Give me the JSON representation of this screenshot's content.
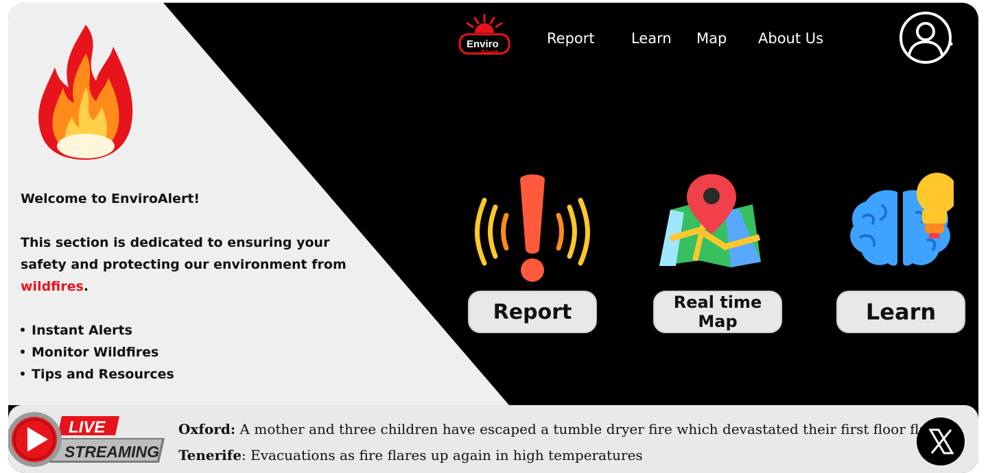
{
  "brand": {
    "name_top": "Enviro",
    "name_bottom": "Alert",
    "accent": "#e8141b"
  },
  "nav": {
    "items": [
      "Report",
      "Learn",
      "Map",
      "About Us"
    ]
  },
  "profile": {
    "icon": "user-icon"
  },
  "intro": {
    "welcome": "Welcome to EnviroAlert!",
    "text_before": "This section  is dedicated to ensuring your safety and protecting our environment from ",
    "highlight": "wildfires",
    "text_after": ".",
    "features": [
      "Instant Alerts",
      "Monitor Wildfires",
      "Tips and Resources"
    ]
  },
  "cards": [
    {
      "label": "Report",
      "icon": "alert-icon"
    },
    {
      "label": "Real time Map",
      "icon": "map-pin-icon"
    },
    {
      "label": "Learn",
      "icon": "brain-bulb-icon"
    }
  ],
  "ticker": {
    "badge_top": "LIVE",
    "badge_bottom": "STREAMING",
    "items": [
      {
        "place": "Oxford:",
        "text": " A mother and three children have escaped a tumble dryer fire which devastated their first floor flat."
      },
      {
        "place": "Tenerife",
        "text": ": Evacuations as fire flares up again in high temperatures"
      }
    ],
    "social_icon": "x-logo-icon"
  },
  "colors": {
    "dark_bg": "#000000",
    "light_bg": "#efefef",
    "button_bg": "#e8e8e8",
    "news_bg": "#e9e9e9"
  }
}
